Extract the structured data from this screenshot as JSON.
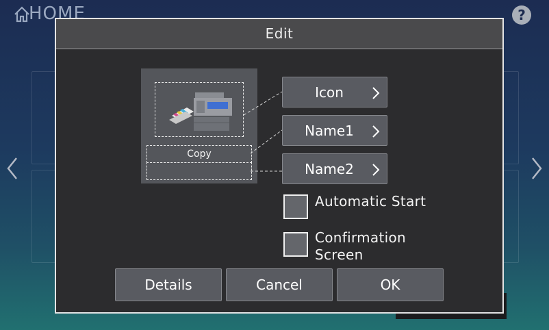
{
  "home": {
    "title": "HOME",
    "icon": "home-icon",
    "help_icon": "help-icon",
    "help_glyph": "?"
  },
  "dialog": {
    "title": "Edit",
    "preview": {
      "icon": "copier-icon",
      "name1_text": "Copy",
      "name2_text": ""
    },
    "side_buttons": [
      {
        "label": "Icon",
        "icon": "chevron-right-icon"
      },
      {
        "label": "Name1",
        "icon": "chevron-right-icon"
      },
      {
        "label": "Name2",
        "icon": "chevron-right-icon"
      }
    ],
    "checkboxes": [
      {
        "label": "Automatic Start",
        "checked": false
      },
      {
        "label_line1": "Confirmation",
        "label_line2": "Screen",
        "checked": false
      }
    ],
    "buttons": {
      "details": "Details",
      "cancel": "Cancel",
      "ok": "OK"
    }
  },
  "colors": {
    "dialog_bg": "#2c2c2e",
    "title_bar": "#4a4a4c",
    "button_bg": "#595b61",
    "tile_bg": "#54565b"
  }
}
